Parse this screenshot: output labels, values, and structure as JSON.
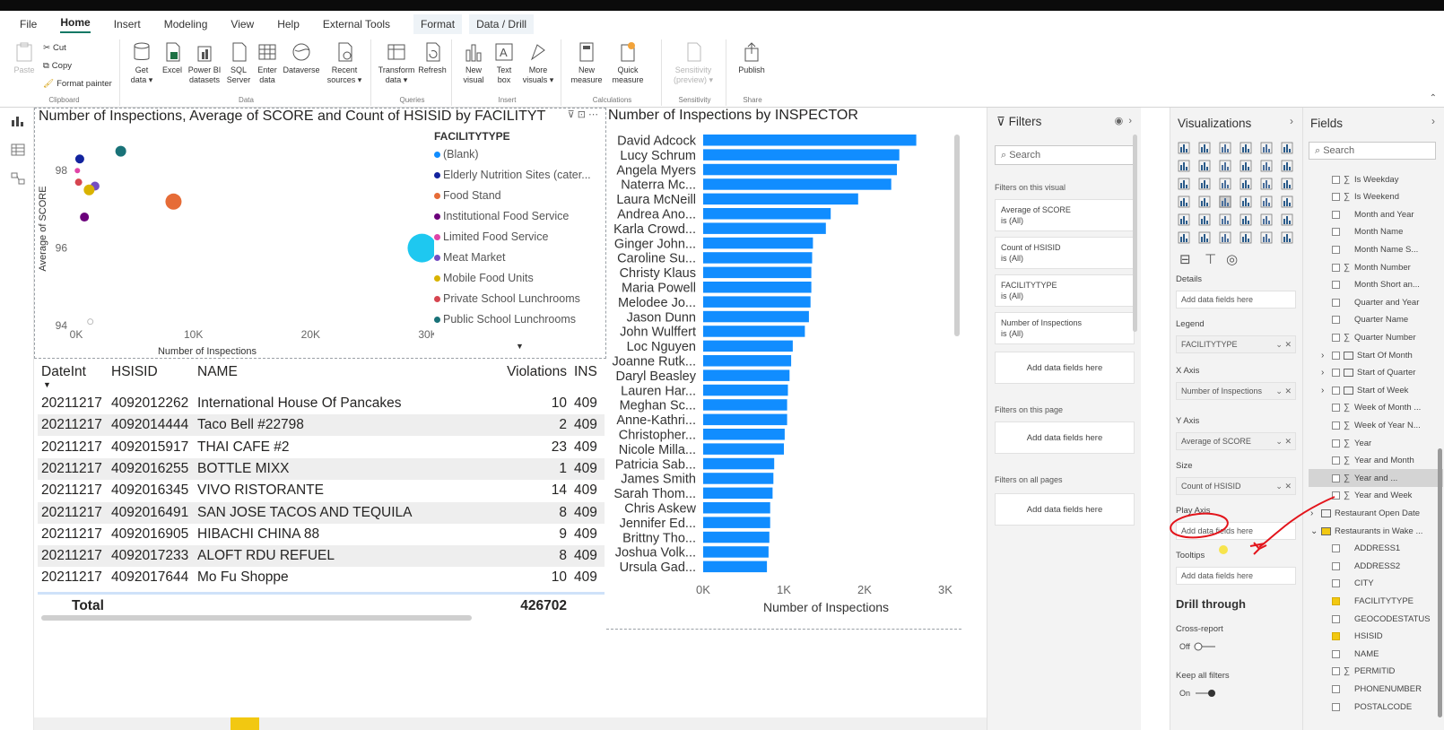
{
  "menu": {
    "items": [
      "File",
      "Home",
      "Insert",
      "Modeling",
      "View",
      "Help",
      "External Tools",
      "Format",
      "Data / Drill"
    ],
    "active": "Home"
  },
  "ribbon": {
    "clipboard": {
      "paste": "Paste",
      "cut": "Cut",
      "copy": "Copy",
      "format_painter": "Format painter",
      "label": "Clipboard"
    },
    "data": {
      "buttons": [
        "Get data",
        "Excel",
        "Power BI datasets",
        "SQL Server",
        "Enter data",
        "Dataverse",
        "Recent sources"
      ],
      "label": "Data"
    },
    "queries": {
      "buttons": [
        "Transform data",
        "Refresh"
      ],
      "label": "Queries"
    },
    "insert": {
      "buttons": [
        "New visual",
        "Text box",
        "More visuals"
      ],
      "label": "Insert"
    },
    "calculations": {
      "buttons": [
        "New measure",
        "Quick measure"
      ],
      "label": "Calculations"
    },
    "sensitivity": {
      "buttons": [
        "Sensitivity (preview)"
      ],
      "label": "Sensitivity"
    },
    "share": {
      "buttons": [
        "Publish"
      ],
      "label": "Share"
    }
  },
  "scatter": {
    "title": "Number of Inspections, Average of SCORE and Count of HSISID by FACILITYTYPE",
    "legend_title": "FACILITYTYPE",
    "legend": [
      {
        "label": "(Blank)",
        "color": "#118dff"
      },
      {
        "label": "Elderly Nutrition Sites (cater...",
        "color": "#12239e"
      },
      {
        "label": "Food Stand",
        "color": "#e66c37"
      },
      {
        "label": "Institutional Food Service",
        "color": "#6b007b"
      },
      {
        "label": "Limited Food Service",
        "color": "#e044a7"
      },
      {
        "label": "Meat Market",
        "color": "#744ec2"
      },
      {
        "label": "Mobile Food Units",
        "color": "#d9b300"
      },
      {
        "label": "Private School Lunchrooms",
        "color": "#d64550"
      },
      {
        "label": "Public School Lunchrooms",
        "color": "#197278"
      }
    ]
  },
  "chart_data": [
    {
      "type": "scatter",
      "title": "Number of Inspections, Average of SCORE and Count of HSISID by FACILITYTYPE",
      "xlabel": "Number of Inspections",
      "ylabel": "Average of SCORE",
      "xlim": [
        0,
        30000
      ],
      "ylim": [
        94,
        99
      ],
      "xticks": [
        "0K",
        "10K",
        "20K",
        "30K"
      ],
      "yticks": [
        "94",
        "96",
        "98"
      ],
      "points": [
        {
          "series": "(Blank)",
          "x": 29500,
          "y": 96.0,
          "size": 16,
          "color": "#1ec8f0"
        },
        {
          "series": "Elderly Nutrition Sites (cater...",
          "x": 300,
          "y": 98.3,
          "size": 5,
          "color": "#12239e"
        },
        {
          "series": "Food Stand",
          "x": 8300,
          "y": 97.2,
          "size": 9,
          "color": "#e66c37"
        },
        {
          "series": "Institutional Food Service",
          "x": 700,
          "y": 96.8,
          "size": 5,
          "color": "#6b007b"
        },
        {
          "series": "Limited Food Service",
          "x": 100,
          "y": 98.0,
          "size": 3,
          "color": "#e044a7"
        },
        {
          "series": "Meat Market",
          "x": 1600,
          "y": 97.6,
          "size": 5,
          "color": "#744ec2"
        },
        {
          "series": "Mobile Food Units",
          "x": 1100,
          "y": 97.5,
          "size": 6,
          "color": "#d9b300"
        },
        {
          "series": "Private School Lunchrooms",
          "x": 200,
          "y": 97.7,
          "size": 4,
          "color": "#d64550"
        },
        {
          "series": "Public School Lunchrooms",
          "x": 3800,
          "y": 98.5,
          "size": 6,
          "color": "#197278"
        },
        {
          "series": "",
          "x": 1200,
          "y": 94.1,
          "size": 3,
          "color": "#c8c8c8"
        }
      ]
    },
    {
      "type": "bar",
      "title": "Number of Inspections by INSPECTOR",
      "xlabel": "Number of Inspections",
      "ylabel": "",
      "xlim": [
        0,
        3000
      ],
      "xticks": [
        "0K",
        "1K",
        "2K",
        "3K"
      ],
      "categories": [
        "David Adcock",
        "Lucy Schrum",
        "Angela Myers",
        "Naterra Mc...",
        "Laura McNeill",
        "Andrea Ano...",
        "Karla Crowd...",
        "Ginger John...",
        "Caroline Su...",
        "Christy Klaus",
        "Maria Powell",
        "Melodee Jo...",
        "Jason Dunn",
        "John Wulffert",
        "Loc Nguyen",
        "Joanne Rutk...",
        "Daryl Beasley",
        "Lauren Har...",
        "Meghan Sc...",
        "Anne-Kathri...",
        "Christopher...",
        "Nicole Milla...",
        "Patricia Sab...",
        "James Smith",
        "Sarah Thom...",
        "Chris Askew",
        "Jennifer Ed...",
        "Brittny Tho...",
        "Joshua Volk...",
        "Ursula Gad..."
      ],
      "values": [
        2640,
        2430,
        2400,
        2330,
        1920,
        1580,
        1520,
        1360,
        1350,
        1340,
        1340,
        1330,
        1310,
        1260,
        1110,
        1090,
        1070,
        1050,
        1040,
        1040,
        1010,
        1000,
        880,
        870,
        860,
        830,
        830,
        820,
        810,
        790
      ],
      "color": "#118dff"
    }
  ],
  "table": {
    "headers": [
      "DateInt",
      "HSISID",
      "NAME",
      "Violations",
      "INS"
    ],
    "rows": [
      [
        "20211217",
        "4092012262",
        "International House Of Pancakes",
        "10",
        "409"
      ],
      [
        "20211217",
        "4092014444",
        "Taco Bell #22798",
        "2",
        "409"
      ],
      [
        "20211217",
        "4092015917",
        "THAI CAFE #2",
        "23",
        "409"
      ],
      [
        "20211217",
        "4092016255",
        "BOTTLE MIXX",
        "1",
        "409"
      ],
      [
        "20211217",
        "4092016345",
        "VIVO RISTORANTE",
        "14",
        "409"
      ],
      [
        "20211217",
        "4092016491",
        "SAN JOSE TACOS AND TEQUILA",
        "8",
        "409"
      ],
      [
        "20211217",
        "4092016905",
        "HIBACHI CHINA 88",
        "9",
        "409"
      ],
      [
        "20211217",
        "4092017233",
        "ALOFT RDU REFUEL",
        "8",
        "409"
      ],
      [
        "20211217",
        "4092017644",
        "Mo Fu Shoppe",
        "10",
        "409"
      ]
    ],
    "total_label": "Total",
    "total_value": "426702"
  },
  "filters": {
    "title": "Filters",
    "search_placeholder": "Search",
    "on_visual_label": "Filters on this visual",
    "cards": [
      {
        "name": "Average of SCORE",
        "state": "is (All)"
      },
      {
        "name": "Count of HSISID",
        "state": "is (All)"
      },
      {
        "name": "FACILITYTYPE",
        "state": "is (All)"
      },
      {
        "name": "Number of Inspections",
        "state": "is (All)"
      }
    ],
    "add_here": "Add data fields here",
    "on_page_label": "Filters on this page",
    "all_pages_label": "Filters on all pages"
  },
  "viz": {
    "title": "Visualizations",
    "wells": [
      {
        "label": "Details",
        "value": "Add data fields here",
        "filled": false
      },
      {
        "label": "Legend",
        "value": "FACILITYTYPE",
        "filled": true
      },
      {
        "label": "X Axis",
        "value": "Number of Inspections",
        "filled": true
      },
      {
        "label": "Y Axis",
        "value": "Average of SCORE",
        "filled": true
      },
      {
        "label": "Size",
        "value": "Count of HSISID",
        "filled": true
      },
      {
        "label": "Play Axis",
        "value": "Add data fields here",
        "filled": false
      },
      {
        "label": "Tooltips",
        "value": "Add data fields here",
        "filled": false
      }
    ],
    "drill_title": "Drill through",
    "cross_report": "Cross-report",
    "off": "Off",
    "keep_filters": "Keep all filters",
    "on": "On"
  },
  "fields": {
    "title": "Fields",
    "search_placeholder": "Search",
    "items": [
      {
        "label": "Is Weekday",
        "sigma": true,
        "checked": false,
        "kind": "field"
      },
      {
        "label": "Is Weekend",
        "sigma": true,
        "checked": false,
        "kind": "field"
      },
      {
        "label": "Month and Year",
        "sigma": false,
        "checked": false,
        "kind": "field"
      },
      {
        "label": "Month Name",
        "sigma": false,
        "checked": false,
        "kind": "field"
      },
      {
        "label": "Month Name S...",
        "sigma": false,
        "checked": false,
        "kind": "field"
      },
      {
        "label": "Month Number",
        "sigma": true,
        "checked": false,
        "kind": "field"
      },
      {
        "label": "Month Short an...",
        "sigma": false,
        "checked": false,
        "kind": "field"
      },
      {
        "label": "Quarter and Year",
        "sigma": false,
        "checked": false,
        "kind": "field"
      },
      {
        "label": "Quarter Name",
        "sigma": false,
        "checked": false,
        "kind": "field"
      },
      {
        "label": "Quarter Number",
        "sigma": true,
        "checked": false,
        "kind": "field"
      },
      {
        "label": "Start Of Month",
        "sigma": false,
        "checked": false,
        "kind": "hier"
      },
      {
        "label": "Start of Quarter",
        "sigma": false,
        "checked": false,
        "kind": "hier"
      },
      {
        "label": "Start of Week",
        "sigma": false,
        "checked": false,
        "kind": "hier"
      },
      {
        "label": "Week of Month ...",
        "sigma": true,
        "checked": false,
        "kind": "field"
      },
      {
        "label": "Week of Year N...",
        "sigma": true,
        "checked": false,
        "kind": "field"
      },
      {
        "label": "Year",
        "sigma": true,
        "checked": false,
        "kind": "field"
      },
      {
        "label": "Year and Month",
        "sigma": true,
        "checked": false,
        "kind": "field"
      },
      {
        "label": "Year and ...",
        "sigma": true,
        "checked": false,
        "kind": "field",
        "highlight": true
      },
      {
        "label": "Year and Week",
        "sigma": true,
        "checked": false,
        "kind": "field"
      },
      {
        "label": "Restaurant Open Date",
        "sigma": false,
        "checked": false,
        "kind": "table"
      },
      {
        "label": "Restaurants in Wake ...",
        "sigma": false,
        "checked": true,
        "kind": "table"
      },
      {
        "label": "ADDRESS1",
        "sigma": false,
        "checked": false,
        "kind": "field"
      },
      {
        "label": "ADDRESS2",
        "sigma": false,
        "checked": false,
        "kind": "field"
      },
      {
        "label": "CITY",
        "sigma": false,
        "checked": false,
        "kind": "field"
      },
      {
        "label": "FACILITYTYPE",
        "sigma": false,
        "checked": true,
        "kind": "field"
      },
      {
        "label": "GEOCODESTATUS",
        "sigma": false,
        "checked": false,
        "kind": "field"
      },
      {
        "label": "HSISID",
        "sigma": false,
        "checked": true,
        "kind": "field"
      },
      {
        "label": "NAME",
        "sigma": false,
        "checked": false,
        "kind": "field"
      },
      {
        "label": "PERMITID",
        "sigma": true,
        "checked": false,
        "kind": "field"
      },
      {
        "label": "PHONENUMBER",
        "sigma": false,
        "checked": false,
        "kind": "field"
      },
      {
        "label": "POSTALCODE",
        "sigma": false,
        "checked": false,
        "kind": "field"
      }
    ]
  },
  "colors": {
    "bar": "#118dff",
    "annotation": "#e3141b",
    "accent": "#117865"
  }
}
